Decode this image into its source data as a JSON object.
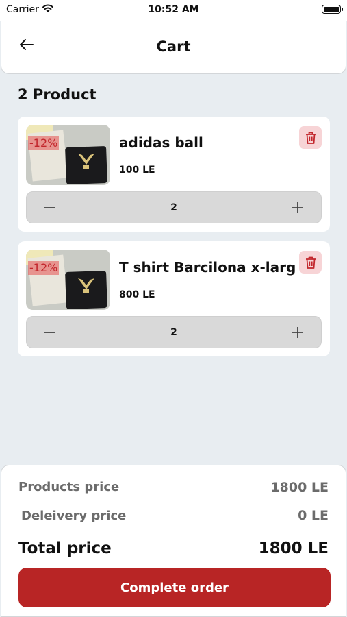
{
  "status_bar": {
    "carrier": "Carrier",
    "time": "10:52 AM"
  },
  "header": {
    "title": "Cart",
    "back_icon": "arrow-left-icon"
  },
  "cart": {
    "count_label": "2 Product",
    "items": [
      {
        "name": "adidas ball",
        "price": "100 LE",
        "discount": "-12%",
        "quantity": "2"
      },
      {
        "name": "T shirt Barcilona x-larg",
        "price": "800 LE",
        "discount": "-12%",
        "quantity": "2"
      }
    ]
  },
  "summary": {
    "products_price_label": "Products price",
    "products_price_value": "1800 LE",
    "delivery_price_label": "Deleivery price",
    "delivery_price_value": "0 LE",
    "total_label": "Total price",
    "total_value": "1800 LE",
    "complete_button": "Complete order"
  },
  "colors": {
    "accent": "#b82525",
    "delete_bg": "#f7d4d6",
    "background": "#e8edf1"
  }
}
